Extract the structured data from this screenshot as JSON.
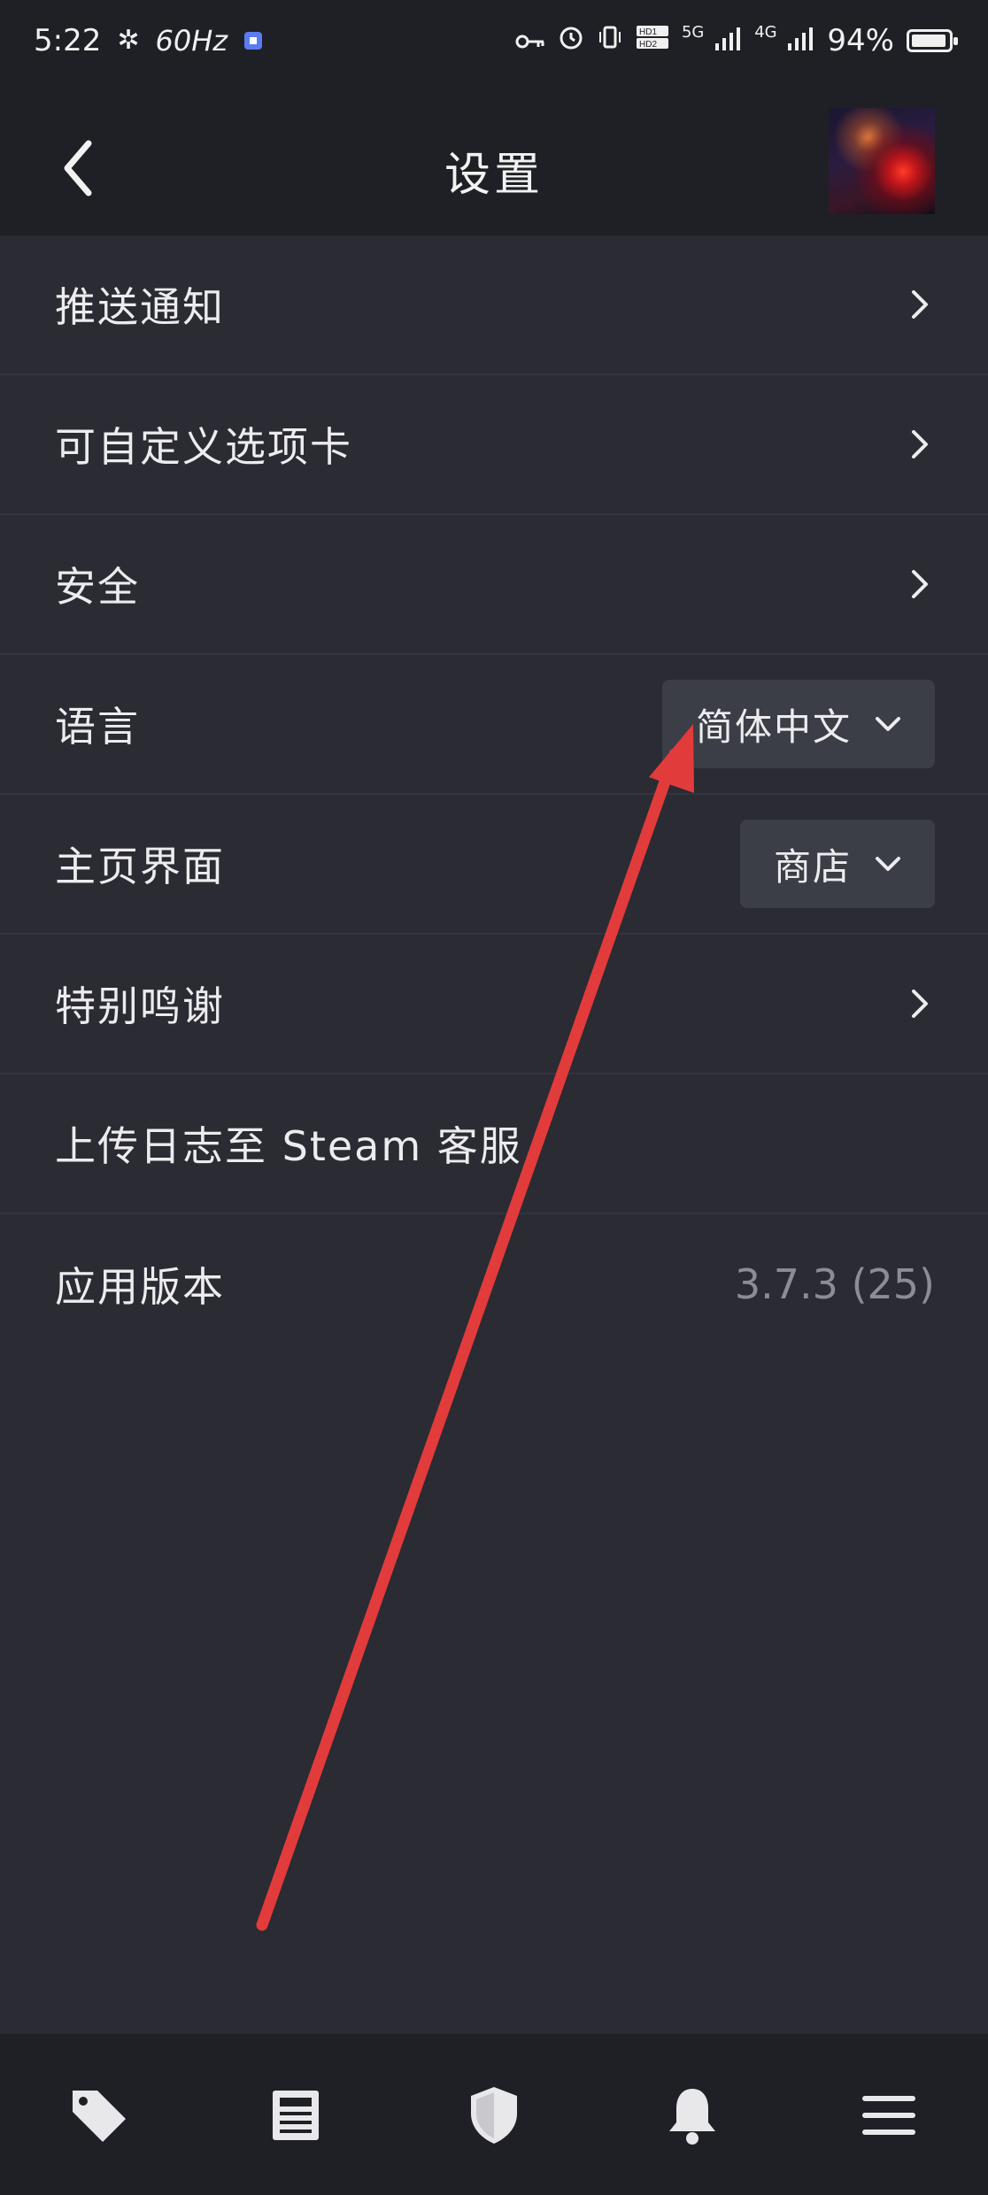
{
  "status_bar": {
    "time": "5:22",
    "refresh_rate": "60Hz",
    "network_5g": "5G",
    "network_4g": "4G",
    "battery_percent": "94%",
    "battery_level": 0.94
  },
  "header": {
    "title": "设置"
  },
  "settings": {
    "push_notifications": "推送通知",
    "custom_tabs": "可自定义选项卡",
    "security": "安全",
    "language_label": "语言",
    "language_value": "简体中文",
    "home_label": "主页界面",
    "home_value": "商店",
    "special_thanks": "特别鸣谢",
    "upload_logs": "上传日志至 Steam 客服",
    "app_version_label": "应用版本",
    "app_version_value": "3.7.3 (25)"
  },
  "bottom_nav": [
    "store-tag-icon",
    "library-news-icon",
    "guard-shield-icon",
    "notifications-bell-icon",
    "menu-icon"
  ],
  "colors": {
    "background": "#2a2b33",
    "header": "#1f2025",
    "dropdown": "#3b3d47",
    "annotation_arrow": "#e23b3b"
  }
}
